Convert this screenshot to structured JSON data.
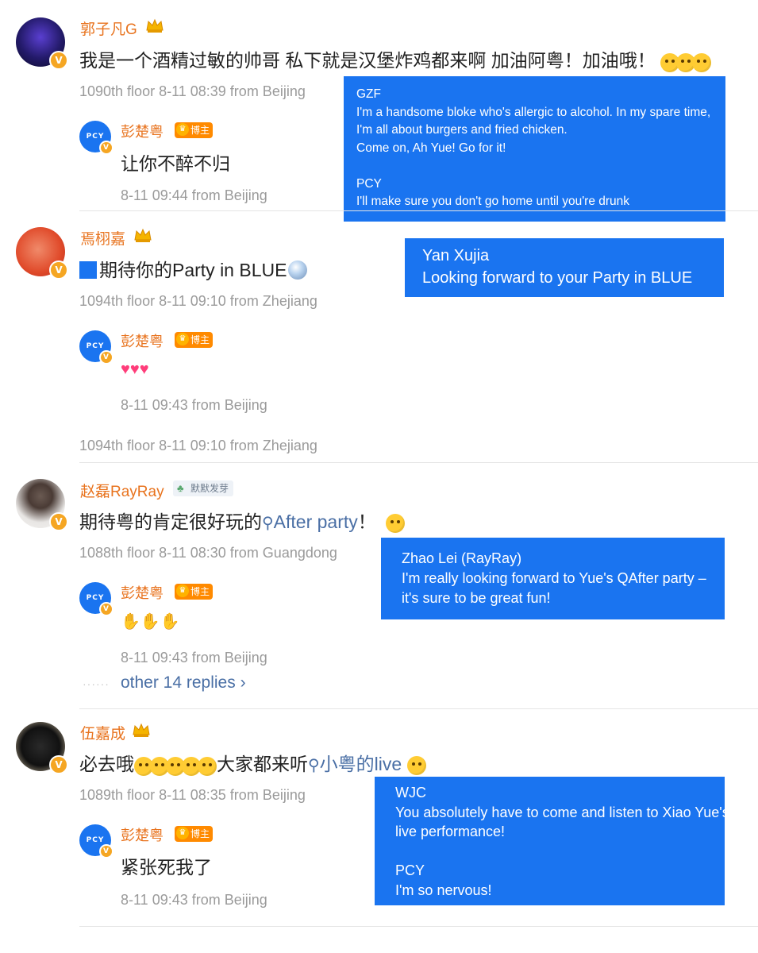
{
  "comments": [
    {
      "name": "郭子凡G",
      "text": "我是一个酒精过敏的帅哥 私下就是汉堡炸鸡都来啊 加油阿粤！加油哦！",
      "meta": "1090th floor 8-11 08:39 from Beijing",
      "reply": {
        "name": "彭楚粤",
        "badge": "博主",
        "text": "让你不醉不归",
        "meta": "8-11 09:44 from Beijing"
      },
      "overlay": [
        "GZF",
        "I'm a handsome bloke who's allergic to alcohol. In my spare time,",
        "I'm all about burgers and fried chicken.",
        "Come on, Ah Yue! Go for it!",
        "",
        "PCY",
        "I'll make sure you don't go home until you're drunk"
      ]
    },
    {
      "name": "焉栩嘉",
      "text": "期待你的Party in BLUE",
      "meta": "1094th floor 8-11 09:10 from Zhejiang",
      "reply": {
        "name": "彭楚粤",
        "badge": "博主",
        "meta": "8-11 09:43 from Beijing"
      },
      "meta_repeat": "1094th floor 8-11 09:10 from Zhejiang",
      "overlay": [
        "Yan Xujia",
        "Looking forward to your Party in BLUE"
      ]
    },
    {
      "name": "赵磊RayRay",
      "badge": "默默发芽",
      "text_before": "期待粤的肯定很好玩的",
      "text_link": "After party",
      "text_after": "！",
      "meta": "1088th floor 8-11 08:30 from Guangdong",
      "reply": {
        "name": "彭楚粤",
        "badge": "博主",
        "meta": "8-11 09:43 from Beijing"
      },
      "more_replies": "other 14 replies ›",
      "overlay": [
        "Zhao Lei (RayRay)",
        "I'm really looking forward to Yue's QAfter party –",
        "it's sure to be great fun!"
      ]
    },
    {
      "name": "伍嘉成",
      "text_before": "必去哦",
      "text_middle": "大家都来听",
      "text_link": "小粤的live",
      "meta": "1089th floor 8-11 08:35 from Beijing",
      "reply": {
        "name": "彭楚粤",
        "badge": "博主",
        "text": "紧张死我了",
        "meta": "8-11 09:43 from Beijing"
      },
      "overlay": [
        "WJC",
        "You absolutely have to come and listen to Xiao Yue's",
        "live performance!",
        "",
        "PCY",
        "I'm so nervous!"
      ]
    }
  ],
  "icons": {
    "verified": "V",
    "crown": "crown-icon",
    "search": "search-icon"
  },
  "colors": {
    "name": "#e8731e",
    "link": "#4a6fa5",
    "meta": "#9a9a9a",
    "overlay": "#1a74f0"
  }
}
